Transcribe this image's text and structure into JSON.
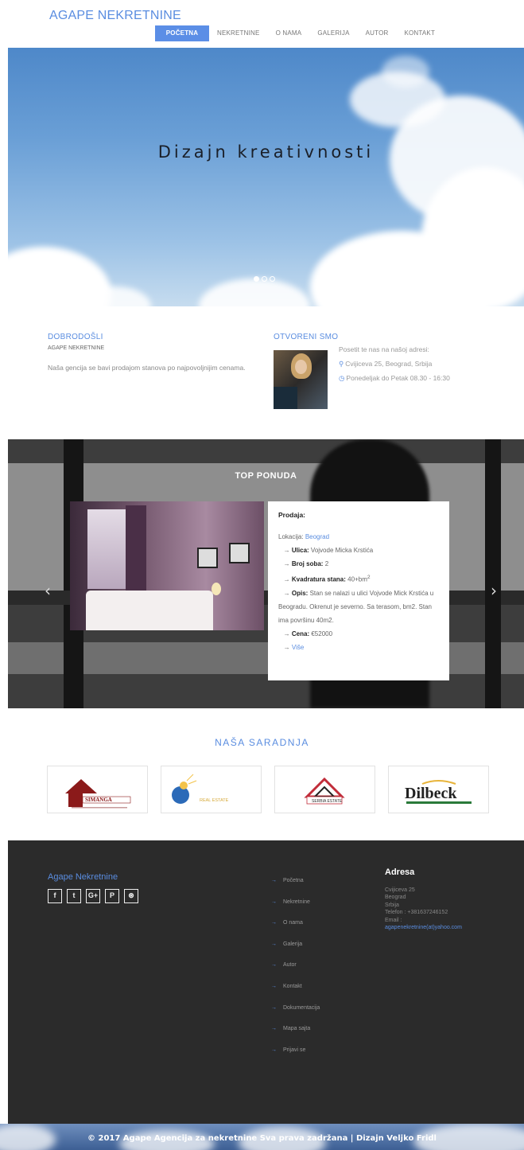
{
  "header": {
    "logo": "AGAPE NEKRETNINE",
    "nav": [
      "POČETNA",
      "NEKRETNINE",
      "O NAMA",
      "GALERIJA",
      "AUTOR",
      "KONTAKT"
    ],
    "active_nav": "POČETNA",
    "accent_color": "#5b8ee6"
  },
  "hero": {
    "title": "Dizajn kreativnosti",
    "slides": 3,
    "active_slide": 1
  },
  "welcome": {
    "heading": "DOBRODOŠLI",
    "subheading": "AGAPE NEKRETNINE",
    "text": "Naša gencija se bavi prodajom stanova po najpovoljnijim cenama."
  },
  "open": {
    "heading": "OTVORENI SMO",
    "intro": "Posetit te nas na našoj adresi:",
    "address": "Cvijiceva 25, Beograd, Srbija",
    "hours": "Ponedeljak do Petak 08.30 - 16:30",
    "address_icon": "map-marker-icon",
    "hours_icon": "clock-icon"
  },
  "top_offer": {
    "title": "TOP PONUDA",
    "type_label": "Prodaja:",
    "location_label": "Lokacija:",
    "location_value": "Beograd",
    "street_label": "Ulica:",
    "street_value": "Vojvode Micka Krstića",
    "rooms_label": "Broj soba:",
    "rooms_value": "2",
    "area_label": "Kvadratura stana:",
    "area_value": "40",
    "area_unit": "m",
    "description_label": "Opis:",
    "description_value": "Stan se nalazi u ulici Vojvode Mick Krstića u Beogradu. Okrenut je severno. Sa terasom, bm2. Stan ima površinu 40m2.",
    "price_label": "Cena:",
    "price_value": "€52000",
    "more_link": "Više",
    "prev_icon": "chevron-left-icon",
    "next_icon": "chevron-right-icon"
  },
  "partners": {
    "title": "NAŠA SARADNJA",
    "names": [
      "SIMANGA",
      "REAL ESTATE",
      "SERBIA ESTATE",
      "Dilbeck"
    ]
  },
  "footer": {
    "brand": "Agape Nekretnine",
    "social": [
      "f",
      "t",
      "G+",
      "P",
      "⊛"
    ],
    "links": [
      "Početna",
      "Nekretnine",
      "O nama",
      "Galerija",
      "Autor",
      "Kontakt",
      "Dokumentacija",
      "Mapa sajta",
      "Prijavi se"
    ],
    "address_heading": "Adresa",
    "address_lines": [
      "Cvijiceva 25",
      "Beograd",
      "Srbija",
      "Telefon : +381637246152",
      "Email :"
    ],
    "email": "agapenekretnine(at)yahoo.com",
    "copyright": "© 2017 Agape Agencija za nekretnine Sva prava zadržana | Dizajn Veljko Fridl"
  }
}
